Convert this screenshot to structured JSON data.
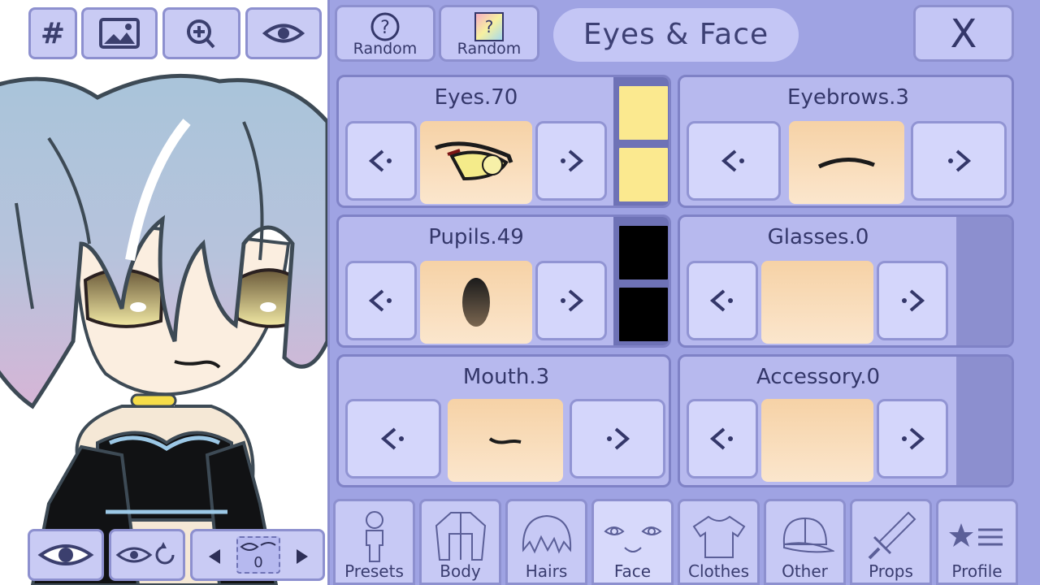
{
  "toolbar": {
    "grid_label": "#"
  },
  "pager": {
    "page": "0"
  },
  "header": {
    "random_pose_label": "Random",
    "random_color_label": "Random",
    "title": "Eyes & Face",
    "close_label": "X"
  },
  "cards": {
    "eyes": {
      "title": "Eyes.70"
    },
    "eyebrows": {
      "title": "Eyebrows.3"
    },
    "pupils": {
      "title": "Pupils.49"
    },
    "glasses": {
      "title": "Glasses.0"
    },
    "mouth": {
      "title": "Mouth.3"
    },
    "accessory": {
      "title": "Accessory.0"
    }
  },
  "colors": {
    "eye_color_1": "#fbe98f",
    "eye_color_2": "#fbe98f",
    "pupil_color_1": "#000000",
    "pupil_color_2": "#000000"
  },
  "tabs": [
    {
      "label": "Presets",
      "icon": "person-icon"
    },
    {
      "label": "Body",
      "icon": "jacket-icon"
    },
    {
      "label": "Hairs",
      "icon": "hair-icon"
    },
    {
      "label": "Face",
      "icon": "face-icon",
      "active": true
    },
    {
      "label": "Clothes",
      "icon": "shirt-icon"
    },
    {
      "label": "Other",
      "icon": "cap-icon"
    },
    {
      "label": "Props",
      "icon": "sword-icon"
    },
    {
      "label": "Profile",
      "icon": "profile-icon"
    }
  ]
}
